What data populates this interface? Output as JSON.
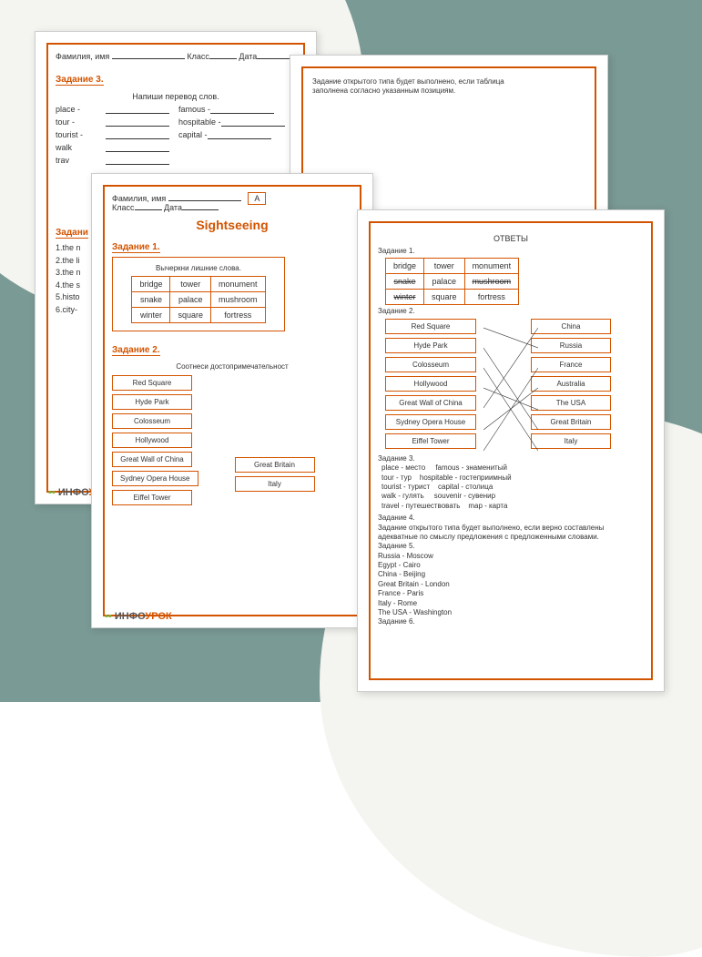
{
  "header": {
    "name_label": "Фамилия, имя",
    "class_label": "Класс",
    "date_label": "Дата"
  },
  "page1": {
    "task3_title": "Задание 3.",
    "instruction": "Напиши перевод слов.",
    "words_left": [
      "place -",
      "tour -",
      "tourist -",
      "walk",
      "trav"
    ],
    "words_right": [
      "famous -",
      "hospitable -",
      "capital -"
    ],
    "task_cut": "Задани",
    "list_items": [
      "1.the n",
      "2.the li",
      "3.the n",
      "4.the s",
      "5.histo",
      "6.city-"
    ]
  },
  "page2": {
    "title": "Sightseeing",
    "task1_title": "Задание 1.",
    "task1_instruction": "Вычеркни лишние слова.",
    "task1_table": [
      [
        "bridge",
        "tower",
        "monument"
      ],
      [
        "snake",
        "palace",
        "mushroom"
      ],
      [
        "winter",
        "square",
        "fortress"
      ]
    ],
    "task2_title": "Задание 2.",
    "task2_instruction": "Соотнеси достопримечательност",
    "sights": [
      "Red Square",
      "Hyde Park",
      "Colosseum",
      "Hollywood",
      "Great Wall of China",
      "Sydney Opera House",
      "Eiffel Tower"
    ],
    "countries_partial": [
      "Great Britain",
      "Italy"
    ],
    "variant_label": "А"
  },
  "page3": {
    "text_line1": "Задание открытого типа будет выполнено, если таблица",
    "text_line2": "заполнена согласно указанным позициям."
  },
  "page4": {
    "title": "ОТВЕТЫ",
    "task1_title": "Задание 1.",
    "task1_answers": [
      [
        "bridge",
        "tower",
        "monument"
      ],
      [
        "snake",
        "palace",
        "mushroom"
      ],
      [
        "winter",
        "square",
        "fortress"
      ]
    ],
    "task1_strike": [
      [
        false,
        false,
        false
      ],
      [
        true,
        false,
        true
      ],
      [
        true,
        false,
        false
      ]
    ],
    "task2_title": "Задание 2.",
    "task2_sights": [
      "Red Square",
      "Hyde Park",
      "Colosseum",
      "Hollywood",
      "Great Wall of China",
      "Sydney Opera House",
      "Eiffel Tower"
    ],
    "task2_countries": [
      "China",
      "Russia",
      "France",
      "Australia",
      "The USA",
      "Great Britain",
      "Italy"
    ],
    "task3_title": "Задание 3.",
    "task3_text": "place - место     famous - знаменитый\ntour - тур    hospitable - гостеприимный\ntourist - турист    capital - столица\nwalk - гулять     souvenir - сувенир\ntravel - путешествовать    map - карта",
    "task4_title": "Задание 4.",
    "task4_text": "Задание открытого типа будет выполнено, если верно составлены адекватные по смыслу предложения с предложенными словами.",
    "task5_title": "Задание 5.",
    "task5_text": "Russia - Moscow\nEgypt - Cairo\nChina - Beijing\nGreat Britain - London\nFrance - Paris\nItaly - Rome\nThe USA - Washington",
    "task6_title": "Задание 6."
  },
  "logo": {
    "part1": "ИНФО",
    "part2": "УРОК"
  }
}
